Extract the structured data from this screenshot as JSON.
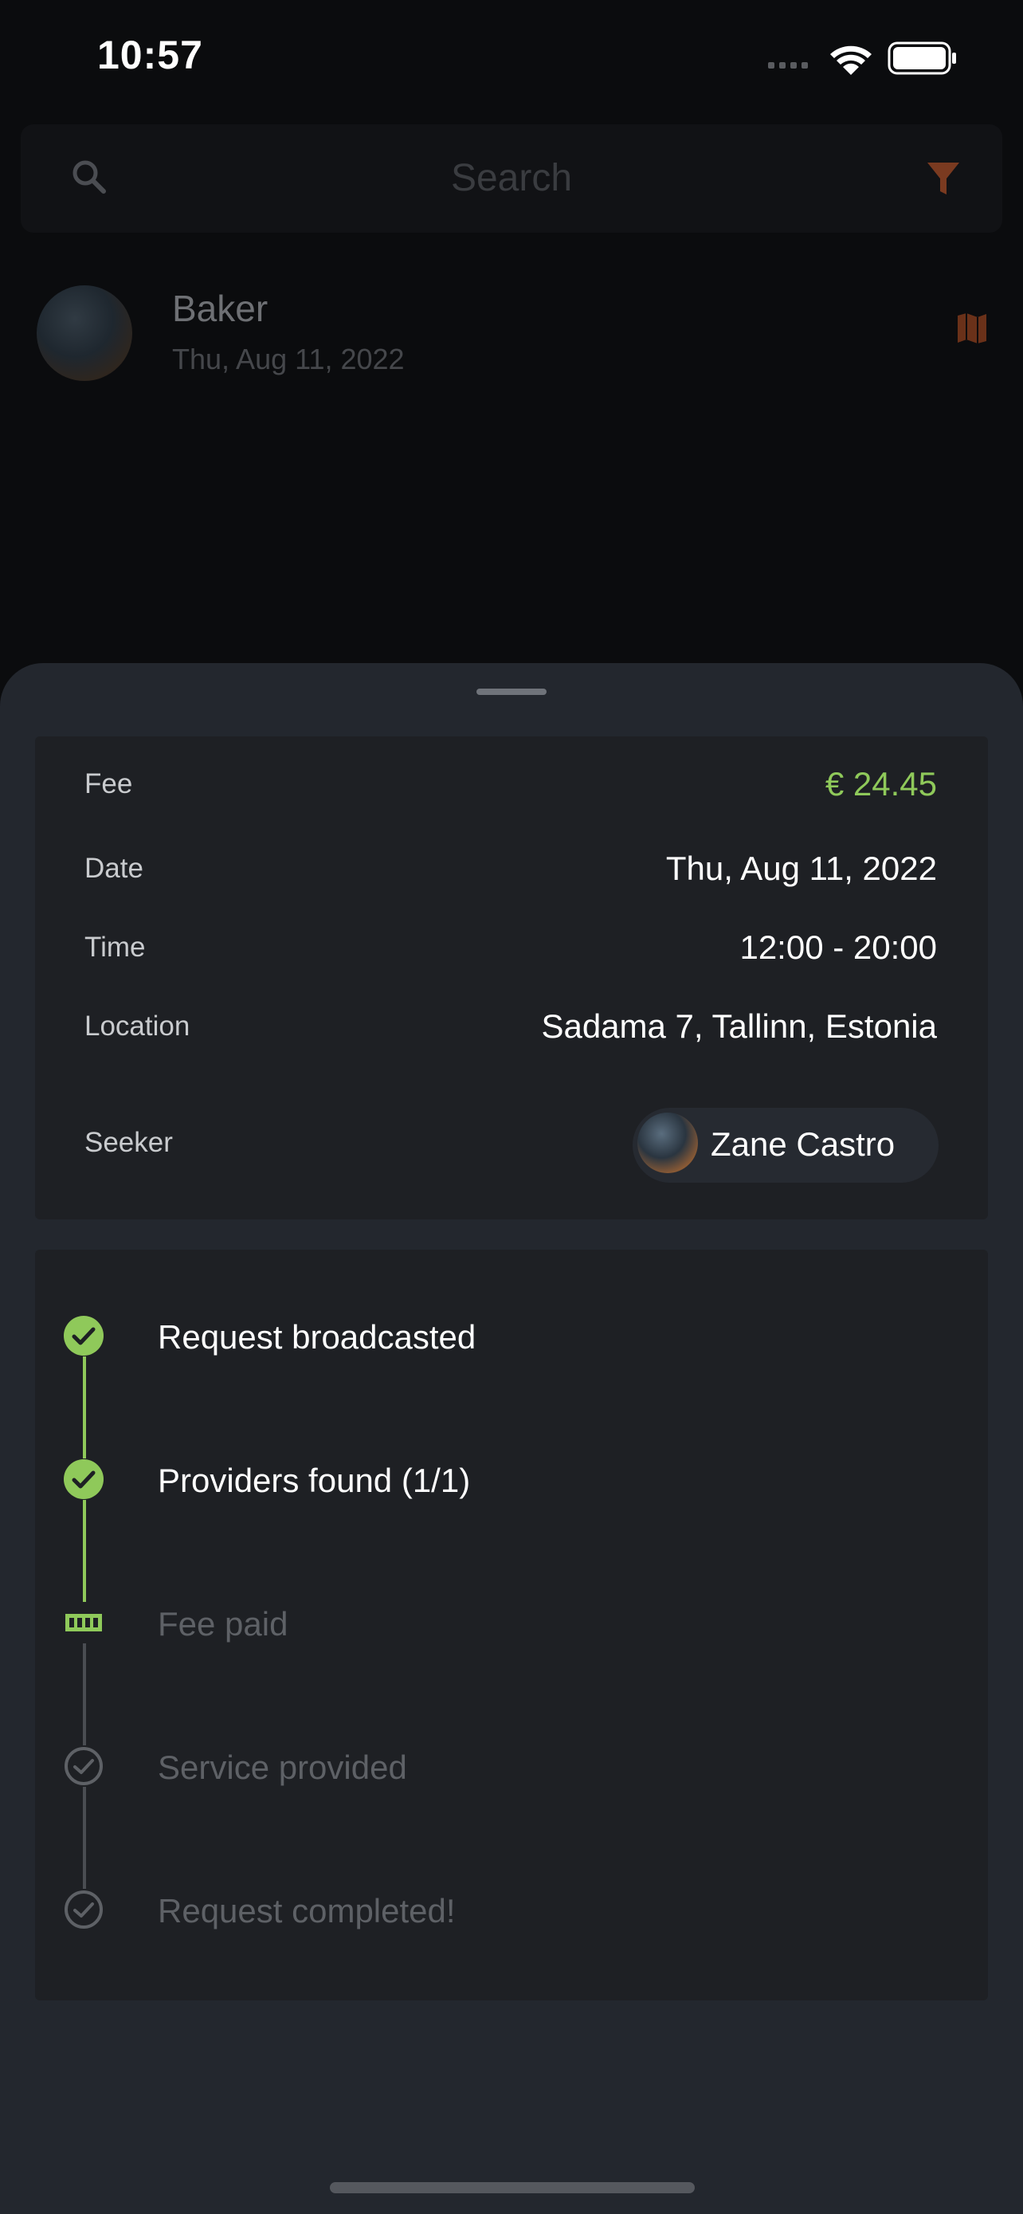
{
  "status_bar": {
    "time": "10:57"
  },
  "search": {
    "placeholder": "Search"
  },
  "list": {
    "items": [
      {
        "title": "Baker",
        "date": "Thu, Aug 11, 2022"
      }
    ]
  },
  "details": {
    "fee_label": "Fee",
    "fee_value": "€ 24.45",
    "date_label": "Date",
    "date_value": "Thu, Aug 11, 2022",
    "time_label": "Time",
    "time_value": "12:00 - 20:00",
    "location_label": "Location",
    "location_value": "Sadama 7, Tallinn, Estonia",
    "seeker_label": "Seeker",
    "seeker_name": "Zane Castro"
  },
  "progress": {
    "steps": [
      {
        "label": "Request broadcasted",
        "status": "done",
        "icon": "check-circle-icon"
      },
      {
        "label": "Providers found (1/1)",
        "status": "done",
        "icon": "check-circle-icon"
      },
      {
        "label": "Fee paid",
        "status": "current",
        "icon": "banknote-icon"
      },
      {
        "label": "Service provided",
        "status": "pending",
        "icon": "check-circle-outline-icon"
      },
      {
        "label": "Request completed!",
        "status": "pending",
        "icon": "check-circle-outline-icon"
      }
    ]
  },
  "colors": {
    "accent_green": "#8fc95a",
    "accent_orange": "#b8552c",
    "sheet_bg": "#23272e",
    "card_bg": "#1e2024"
  }
}
